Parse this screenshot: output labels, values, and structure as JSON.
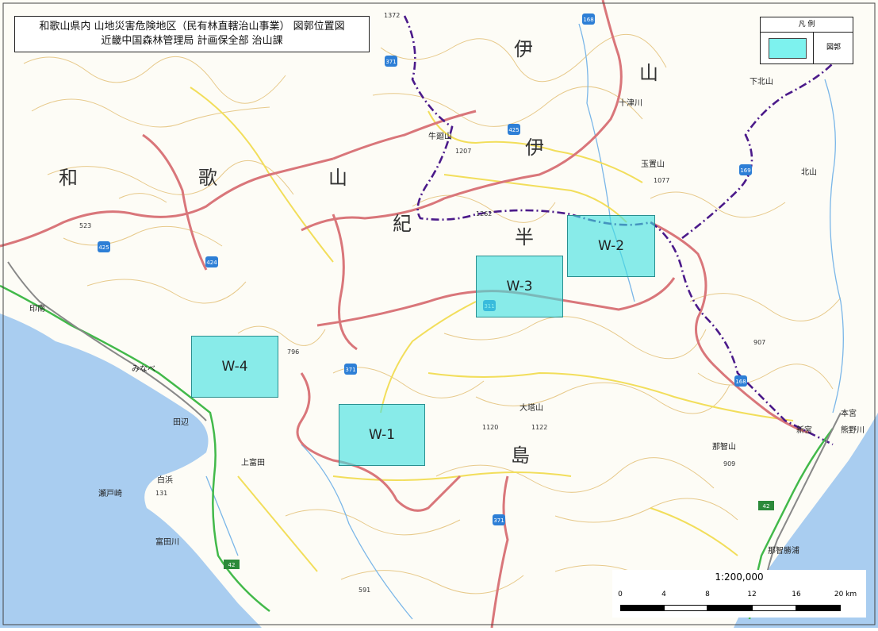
{
  "title": {
    "line1": "和歌山県内  山地災害危険地区（民有林直轄治山事業） 図郭位置図",
    "line2": "近畿中国森林管理局  計画保全部  治山課"
  },
  "legend": {
    "title": "凡 例",
    "label": "図郭",
    "swatch_color": "#7df2ee"
  },
  "zones": [
    {
      "label": "W-1"
    },
    {
      "label": "W-2"
    },
    {
      "label": "W-3"
    },
    {
      "label": "W-4"
    }
  ],
  "region_labels": [
    "和",
    "歌",
    "山",
    "紀",
    "伊",
    "半",
    "島",
    "伊",
    "山"
  ],
  "place_labels": [
    "牛廻山",
    "玉置山",
    "大塔山",
    "那智山",
    "十津川",
    "下北山",
    "北山",
    "印南",
    "みなべ",
    "田辺",
    "上富田",
    "白浜",
    "瀬戸崎",
    "富田川",
    "新宮",
    "熊野川",
    "那智勝浦",
    "本宮"
  ],
  "spot_heights": [
    "1207",
    "1262",
    "1077",
    "523",
    "796",
    "1120",
    "1122",
    "907",
    "909",
    "131",
    "591",
    "1372"
  ],
  "route_numbers": [
    "371",
    "425",
    "424",
    "168",
    "311",
    "371",
    "371",
    "425",
    "168",
    "169",
    "42",
    "42"
  ],
  "scale": {
    "ratio": "1:200,000",
    "ticks": [
      "0",
      "4",
      "8",
      "12",
      "16",
      "20 km"
    ]
  },
  "colors": {
    "sea": "#a9cdf0",
    "land": "#fdfcf6",
    "contour": "#e7c98a",
    "prefecture_boundary": "#d9767a",
    "district_boundary": "#4b1a8a",
    "road_yellow": "#f2de5b",
    "expressway": "#42b94a",
    "river": "#7ab6e8"
  }
}
